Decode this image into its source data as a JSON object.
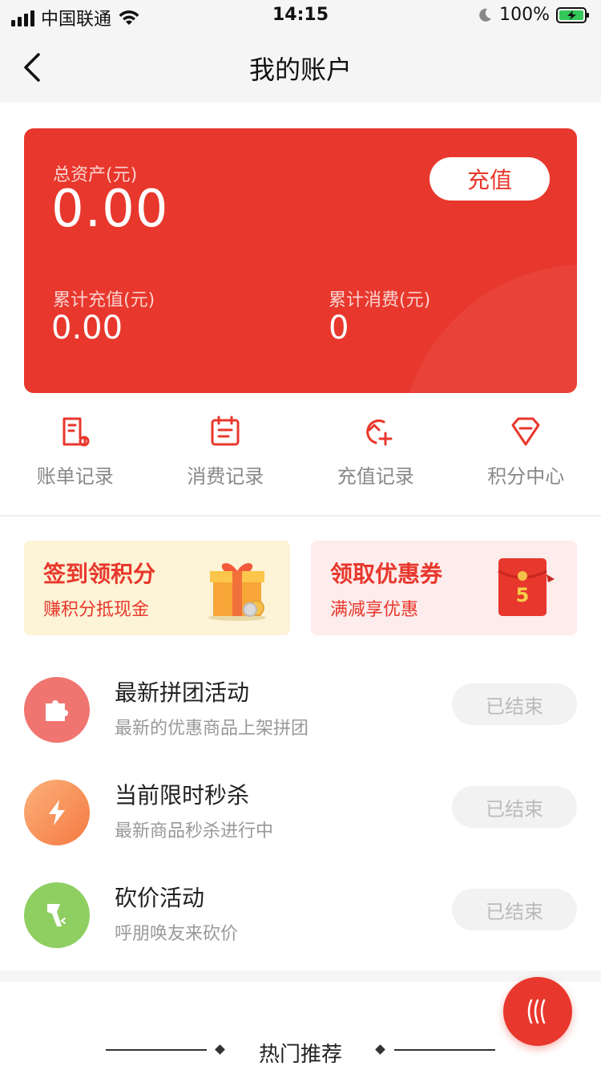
{
  "status_bar": {
    "carrier": "中国联通",
    "time": "14:15",
    "battery": "100%"
  },
  "nav": {
    "title": "我的账户",
    "back_icon": "chevron-left-icon"
  },
  "account_card": {
    "total_label": "总资产(元)",
    "total_value": "0.00",
    "recharge_button": "充值",
    "recharged_label": "累计充值(元)",
    "recharged_value": "0.00",
    "spent_label": "累计消费(元)",
    "spent_value": "0",
    "background_color": "#e8372c"
  },
  "quick_entries": [
    {
      "label": "账单记录",
      "icon": "bill-icon"
    },
    {
      "label": "消费记录",
      "icon": "calendar-icon"
    },
    {
      "label": "充值记录",
      "icon": "recharge-icon"
    },
    {
      "label": "积分中心",
      "icon": "diamond-icon"
    }
  ],
  "promos": {
    "checkin": {
      "title": "签到领积分",
      "subtitle": "赚积分抵现金",
      "icon": "gift-box-icon"
    },
    "coupon": {
      "title": "领取优惠券",
      "subtitle": "满减享优惠",
      "icon": "red-envelope-icon",
      "badge": "5"
    }
  },
  "activities": [
    {
      "title": "最新拼团活动",
      "subtitle": "最新的优惠商品上架拼团",
      "status": "已结束",
      "icon": "puzzle-icon"
    },
    {
      "title": "当前限时秒杀",
      "subtitle": "最新商品秒杀进行中",
      "status": "已结束",
      "icon": "lightning-icon"
    },
    {
      "title": "砍价活动",
      "subtitle": "呼朋唤友来砍价",
      "status": "已结束",
      "icon": "axe-icon"
    }
  ],
  "hot_section": {
    "title": "热门推荐"
  },
  "fab": {
    "icon": "heat-waves-icon"
  }
}
